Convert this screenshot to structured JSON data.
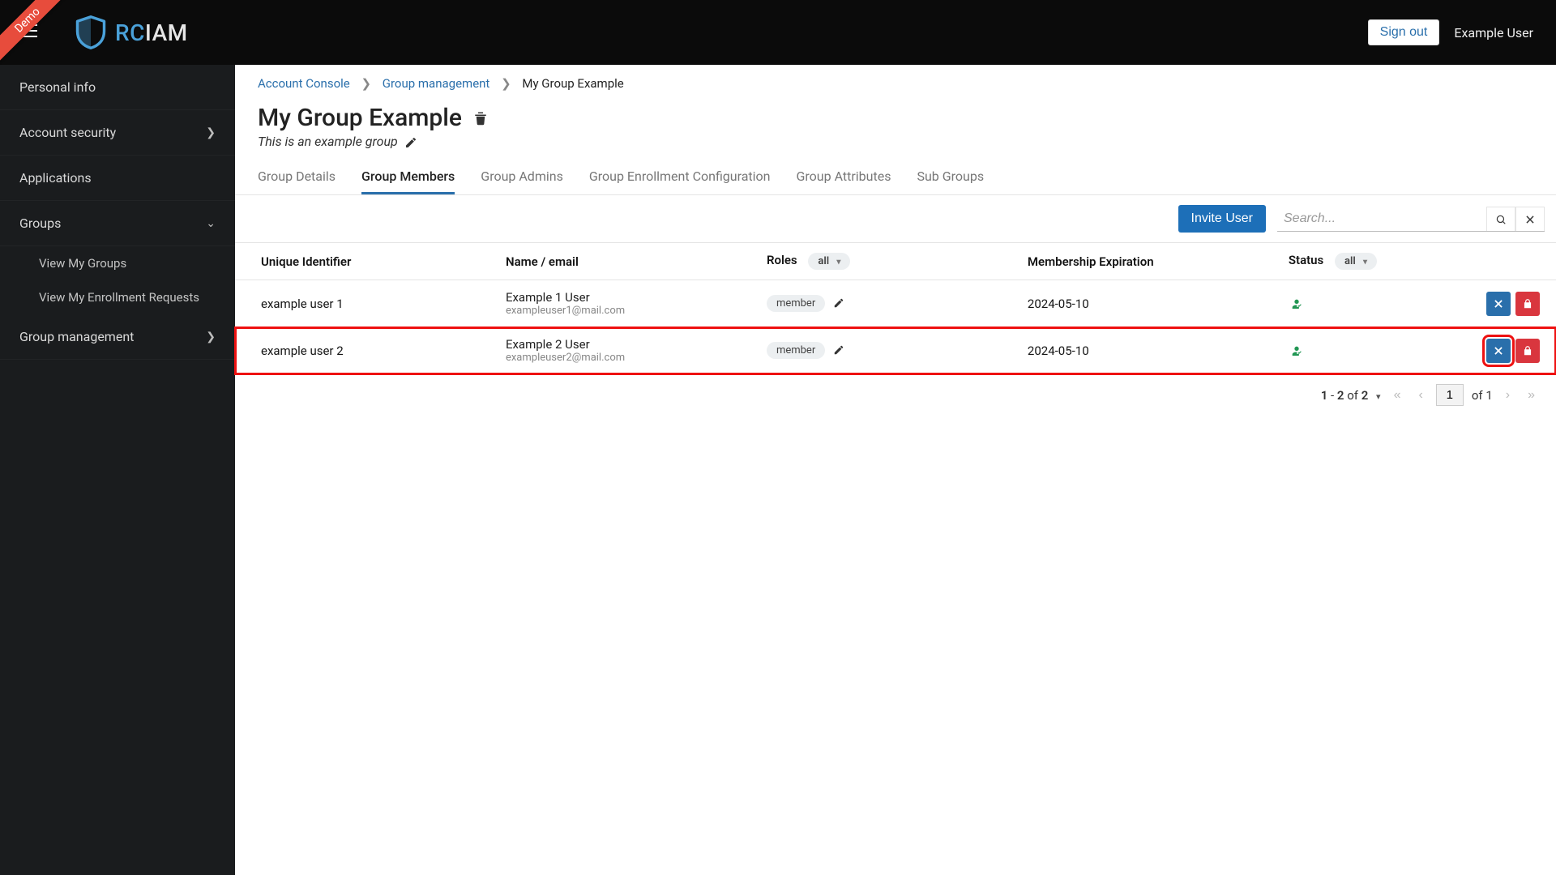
{
  "ribbon": "Demo",
  "logo": {
    "text_a": "RC",
    "text_b": "IAM"
  },
  "topbar": {
    "signout": "Sign out",
    "username": "Example User"
  },
  "sidebar": {
    "items": [
      {
        "label": "Personal info",
        "expandable": false
      },
      {
        "label": "Account security",
        "expandable": true
      },
      {
        "label": "Applications",
        "expandable": false
      },
      {
        "label": "Groups",
        "expandable": true,
        "expanded": true,
        "children": [
          {
            "label": "View My Groups"
          },
          {
            "label": "View My Enrollment Requests"
          }
        ]
      },
      {
        "label": "Group management",
        "expandable": true
      }
    ]
  },
  "breadcrumb": {
    "a": "Account Console",
    "b": "Group management",
    "c": "My Group Example"
  },
  "group": {
    "title": "My Group Example",
    "description": "This is an example group"
  },
  "tabs": {
    "details": "Group Details",
    "members": "Group Members",
    "admins": "Group Admins",
    "enroll": "Group Enrollment Configuration",
    "attrs": "Group Attributes",
    "sub": "Sub Groups"
  },
  "toolbar": {
    "invite": "Invite User",
    "search_placeholder": "Search..."
  },
  "table": {
    "headers": {
      "uid": "Unique Identifier",
      "name": "Name / email",
      "roles": "Roles",
      "roles_filter": "all",
      "expiry": "Membership Expiration",
      "status": "Status",
      "status_filter": "all"
    },
    "rows": [
      {
        "uid": "example user 1",
        "name": "Example 1 User",
        "email": "exampleuser1@mail.com",
        "role": "member",
        "expiry": "2024-05-10",
        "status": "active"
      },
      {
        "uid": "example user 2",
        "name": "Example 2 User",
        "email": "exampleuser2@mail.com",
        "role": "member",
        "expiry": "2024-05-10",
        "status": "active"
      }
    ]
  },
  "pagination": {
    "from": "1",
    "to": "2",
    "of_word": "of",
    "of": "2",
    "page": "1",
    "pages_of_word": "of",
    "pages": "1"
  },
  "highlight": {
    "row_index": 1,
    "action": "remove"
  }
}
